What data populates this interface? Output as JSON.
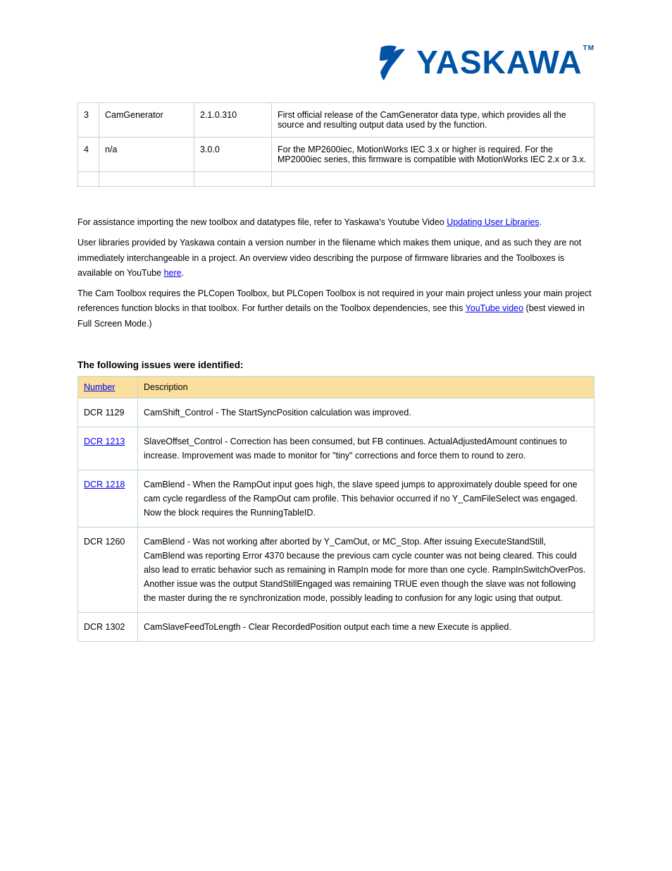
{
  "logo": {
    "text": "YASKAWA"
  },
  "table1": {
    "rows": [
      {
        "c1": "3",
        "c2": "CamGenerator",
        "c3": "2.1.0.310",
        "c4": "First official release of the CamGenerator data type, which provides all the source and resulting output data used by the function."
      },
      {
        "c1": "4",
        "c2": "n/a",
        "c3": "3.0.0",
        "c4": "For the MP2600iec, MotionWorks IEC 3.x or higher is required. For the MP2000iec series, this firmware is compatible with MotionWorks IEC 2.x or 3.x."
      },
      {
        "c1": "",
        "c2": "",
        "c3": "",
        "c4": ""
      }
    ]
  },
  "mid": {
    "p1a": "For assistance importing the new toolbox and datatypes file, refer to Yaskawa's Youtube Video ",
    "p1link": "Updating User Libraries",
    "p1b": ".",
    "p2": "User libraries provided by Yaskawa contain a version number in the filename which makes them unique, and as such they are not immediately interchangeable in a project. An overview video describing the purpose of firmware libraries and the Toolboxes is available on YouTube ",
    "p2link": "here",
    "p2c": ".",
    "p3": "The Cam Toolbox requires the PLCopen Toolbox, but PLCopen Toolbox is not required in your main project unless your main project references function blocks in that toolbox. For further details on the Toolbox dependencies, see this ",
    "p3link": "YouTube video",
    "p3c": " (best viewed in Full Screen Mode.)"
  },
  "heading": "The following issues were identified:",
  "table2": {
    "header": {
      "col1": "Number",
      "col2": "Description"
    },
    "rows": [
      {
        "num": "DCR 1129",
        "desc": "CamShift_Control - The StartSyncPosition calculation was improved."
      },
      {
        "num": "DCR 1213",
        "desc": "SlaveOffset_Control - Correction has been consumed, but FB continues. ActualAdjustedAmount continues to increase. Improvement was made to monitor for \"tiny\" corrections and force them to round to zero."
      },
      {
        "num": "DCR 1218",
        "desc": "CamBlend - When the RampOut input goes high, the slave speed jumps to approximately double speed for one cam cycle regardless of the RampOut cam profile. This behavior occurred if no Y_CamFileSelect was engaged. Now the block requires the RunningTableID."
      },
      {
        "num": "DCR 1260",
        "desc": "CamBlend - Was not working after aborted by Y_CamOut, or MC_Stop. After issuing ExecuteStandStill, CamBlend was reporting Error 4370 because the previous cam cycle counter was not being cleared. This could also lead to erratic behavior such as remaining in RampIn mode for more than one cycle. RampInSwitchOverPos. Another issue was the output StandStillEngaged was remaining TRUE even though the slave was not following the master during the re synchronization mode, possibly leading to confusion for any logic using that output."
      },
      {
        "num": "DCR 1302",
        "desc": "CamSlaveFeedToLength - Clear RecordedPosition output each time a new Execute is applied."
      }
    ]
  }
}
